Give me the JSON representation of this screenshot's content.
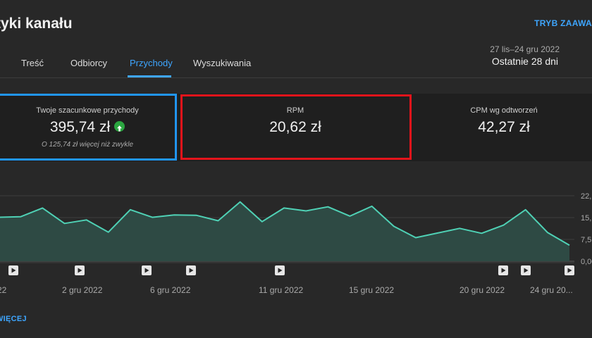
{
  "header": {
    "title": "tyki kanału",
    "advanced_mode": "TRYB ZAAWA"
  },
  "tabs": [
    {
      "label": "Treść",
      "active": false
    },
    {
      "label": "Odbiorcy",
      "active": false
    },
    {
      "label": "Przychody",
      "active": true
    },
    {
      "label": "Wyszukiwania",
      "active": false
    }
  ],
  "date_range": {
    "range": "27 lis–24 gru 2022",
    "period": "Ostatnie 28 dni"
  },
  "cards": [
    {
      "label": "Twoje szacunkowe przychody",
      "value": "395,74 zł",
      "note": "O 125,74 zł więcej niż zwykle",
      "trend_icon": "arrow-up-icon"
    },
    {
      "label": "RPM",
      "value": "20,62 zł"
    },
    {
      "label": "CPM wg odtworzeń",
      "value": "42,27 zł"
    }
  ],
  "colors": {
    "accent": "#3ea6ff",
    "line": "#4fd1b5",
    "area": "#2e4a44",
    "highlight_blue": "#2196f3",
    "highlight_red": "#e4141b",
    "trend_up": "#2ba640"
  },
  "chart_data": {
    "type": "area",
    "y_ticks": [
      "22,",
      "15,",
      "7,5",
      "0,00"
    ],
    "x_tick_labels": [
      "22",
      "2 gru 2022",
      "6 gru 2022",
      "11 gru 2022",
      "15 gru 2022",
      "20 gru 2022",
      "24 gru 20..."
    ],
    "ylim": [
      0,
      22.5
    ],
    "values": [
      15.1,
      15.3,
      18.3,
      13.0,
      14.2,
      10.0,
      17.7,
      15.1,
      15.9,
      15.8,
      13.9,
      20.4,
      13.6,
      18.3,
      17.3,
      18.7,
      15.5,
      18.9,
      12.0,
      8.1,
      9.7,
      11.3,
      9.6,
      12.4,
      17.7,
      9.9,
      5.5
    ],
    "video_markers": 10,
    "grid": true
  },
  "footer": {
    "more_label": "WIĘCEJ"
  }
}
